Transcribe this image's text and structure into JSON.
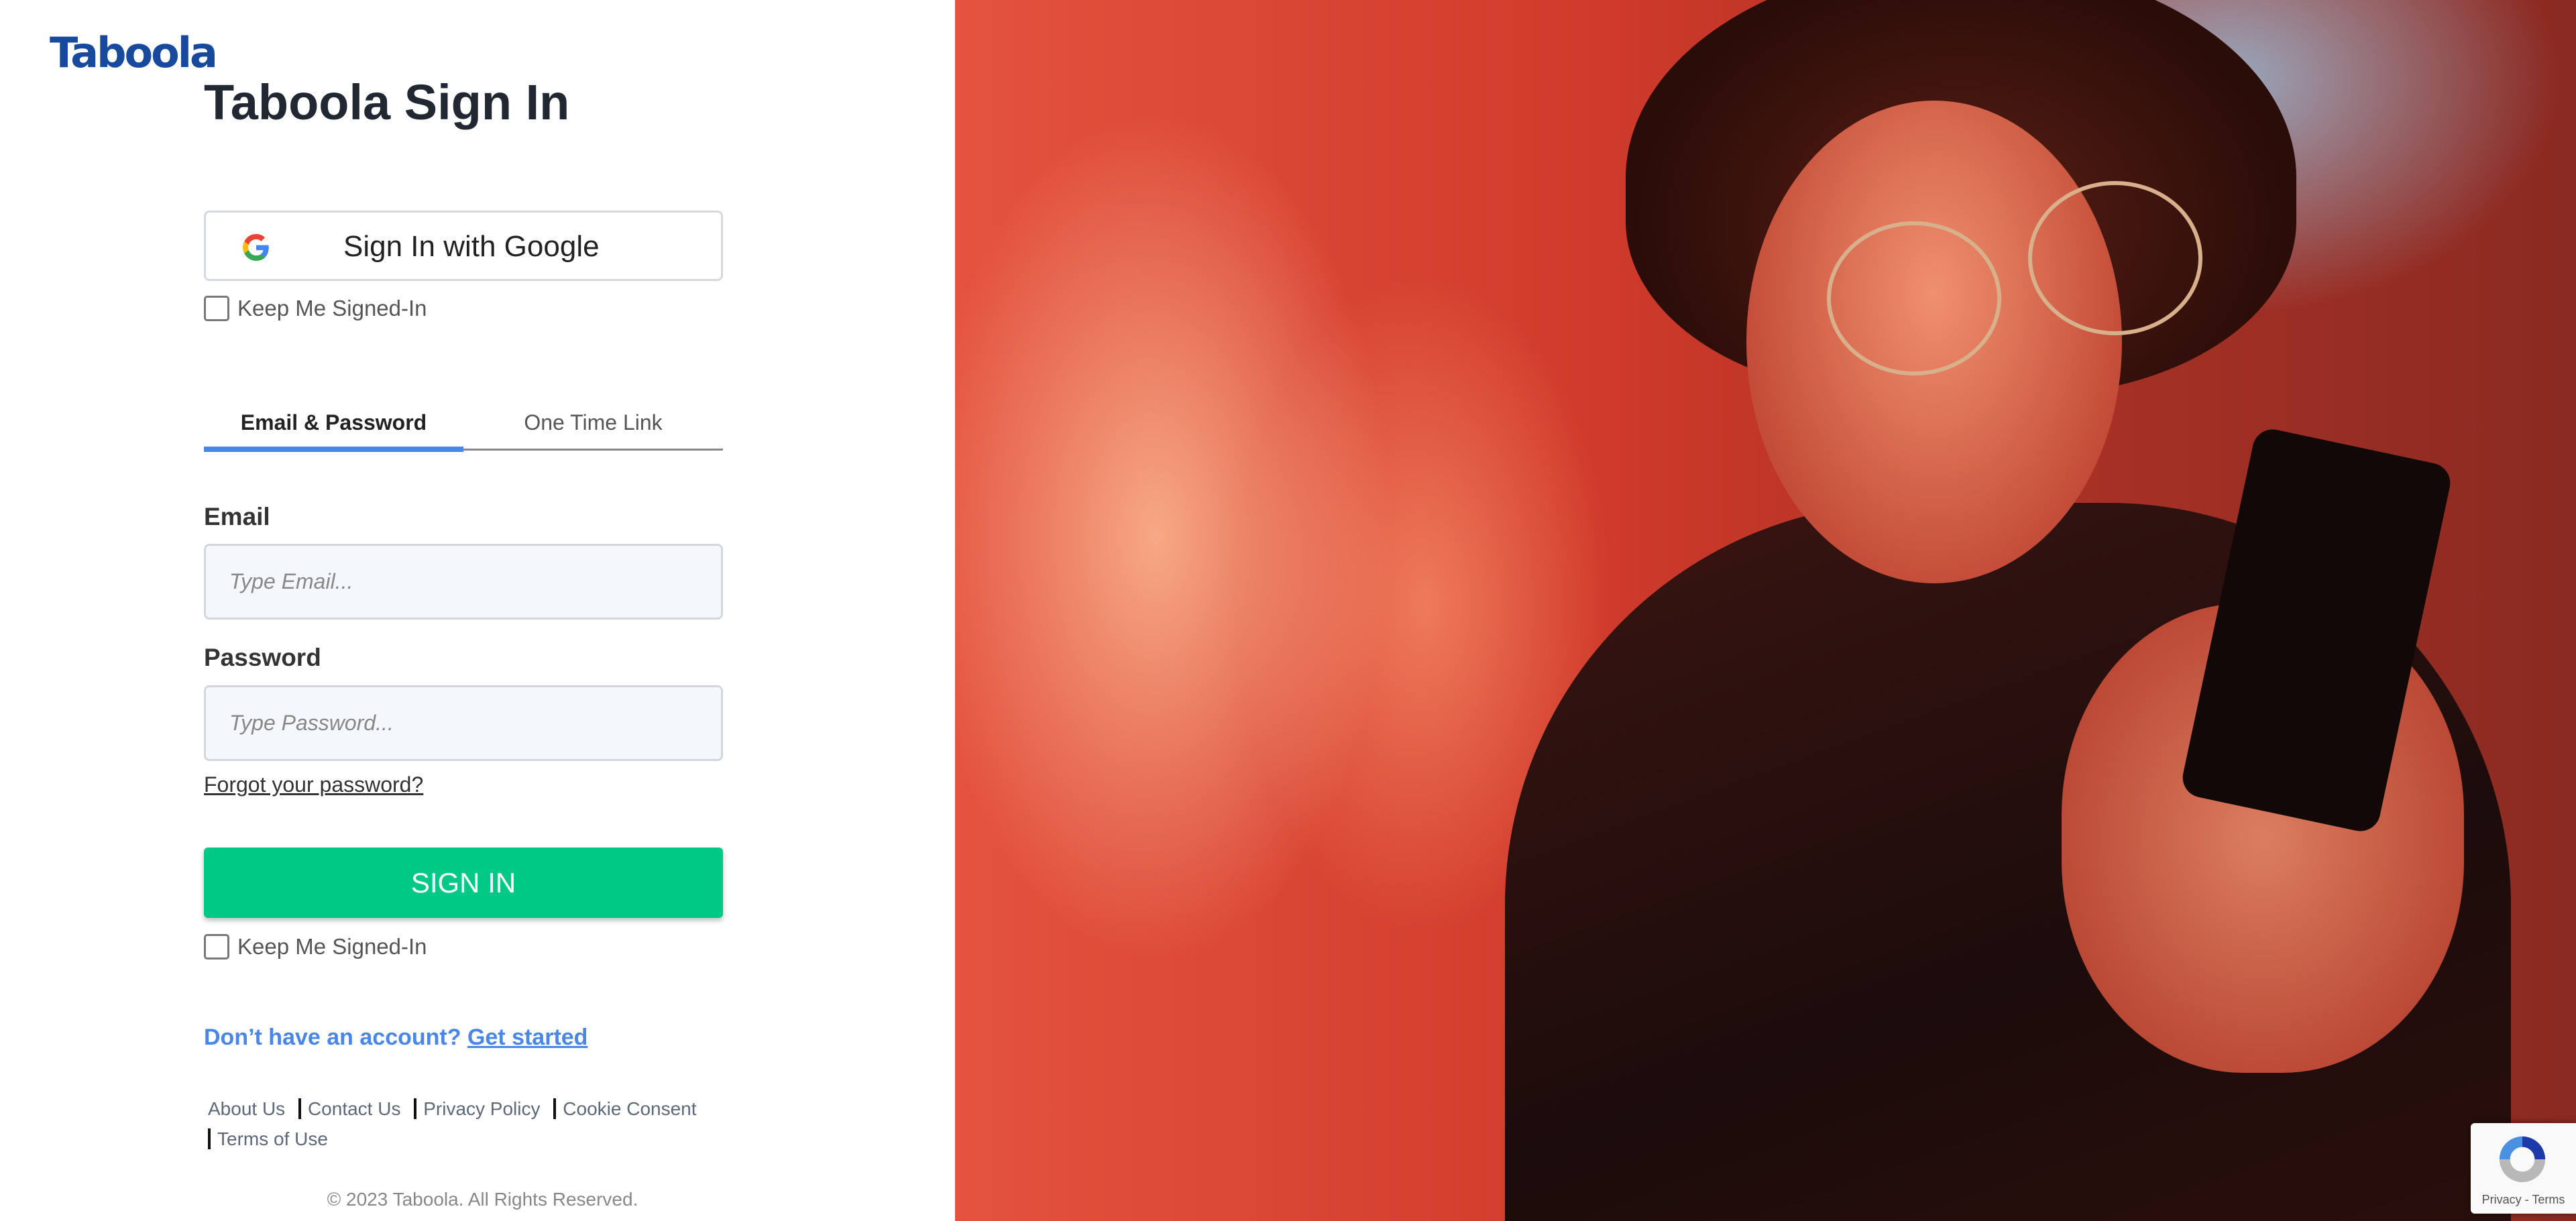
{
  "logo": {
    "text": "Taboola"
  },
  "title": "Taboola Sign In",
  "google_button": {
    "label": "Sign In with Google",
    "icon": "google-icon"
  },
  "keep_signed_in_top": {
    "label": "Keep Me Signed-In",
    "checked": false
  },
  "tabs": [
    {
      "label": "Email & Password",
      "active": true
    },
    {
      "label": "One Time Link",
      "active": false
    }
  ],
  "email": {
    "label": "Email",
    "placeholder": "Type Email...",
    "value": ""
  },
  "password": {
    "label": "Password",
    "placeholder": "Type Password...",
    "value": ""
  },
  "forgot_link": "Forgot your password?",
  "signin_button": "SIGN IN",
  "keep_signed_in_bottom": {
    "label": "Keep Me Signed-In",
    "checked": false
  },
  "account": {
    "question": "Don’t have an account?",
    "link": "Get started"
  },
  "footer": {
    "links": [
      "About Us",
      "Contact Us",
      "Privacy Policy",
      "Cookie Consent",
      "Terms of Use"
    ],
    "copyright": "© 2023 Taboola. All Rights Reserved."
  },
  "recaptcha": {
    "privacy": "Privacy",
    "separator": "-",
    "terms": "Terms"
  },
  "colors": {
    "brand": "#174a9c",
    "accent": "#4a86e8",
    "signin": "#00c986"
  }
}
